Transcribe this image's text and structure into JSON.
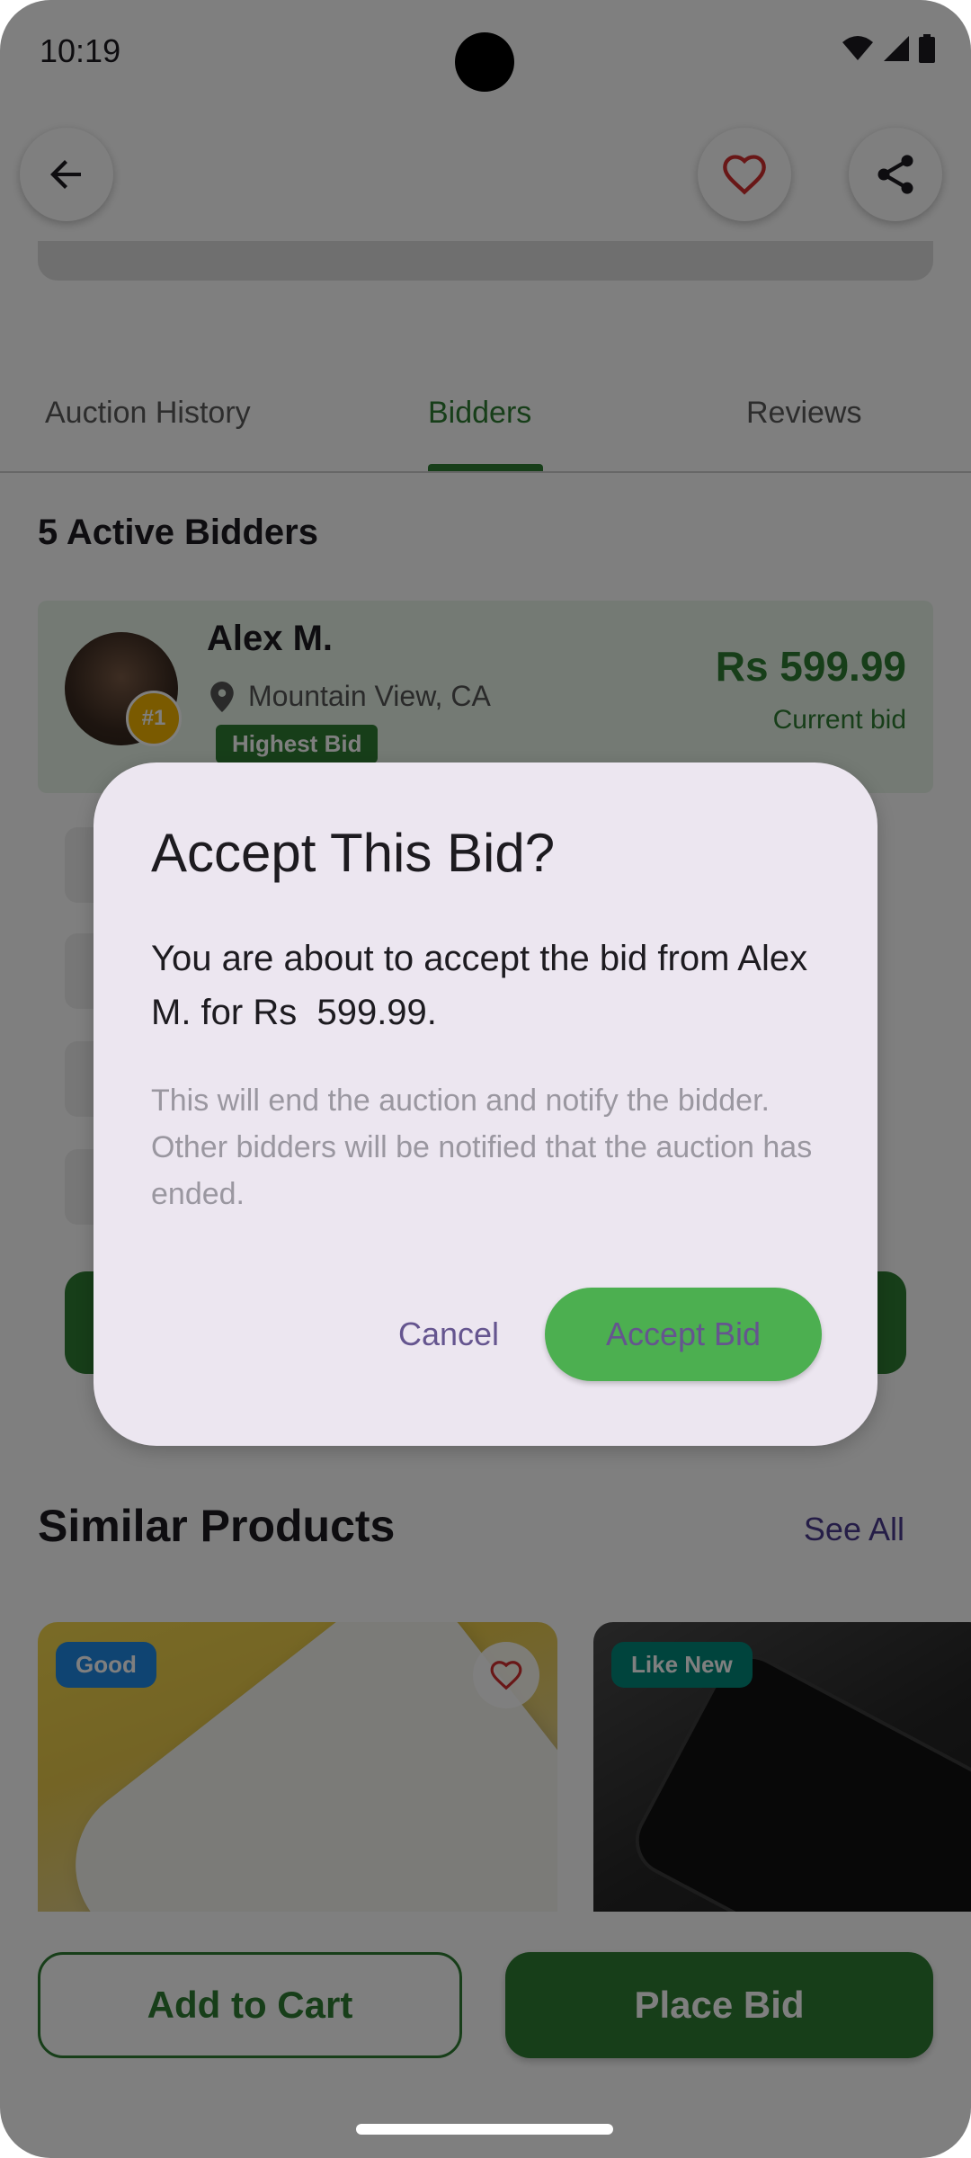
{
  "status_bar": {
    "time": "10:19"
  },
  "tabs": [
    {
      "label": "Auction History"
    },
    {
      "label": "Bidders"
    },
    {
      "label": "Reviews"
    }
  ],
  "bidders": {
    "title": "5 Active Bidders",
    "top": {
      "name": "Alex M.",
      "location": "Mountain View, CA",
      "badge": "Highest Bid",
      "rank": "#1",
      "amount": "Rs 599.99",
      "caption": "Current bid"
    }
  },
  "similar": {
    "title": "Similar Products",
    "see_all": "See All",
    "products": [
      {
        "condition": "Good"
      },
      {
        "condition": "Like New"
      }
    ]
  },
  "actions": {
    "add_to_cart": "Add to Cart",
    "place_bid": "Place Bid"
  },
  "dialog": {
    "title": "Accept This Bid?",
    "body": "You are about to accept the bid from Alex M. for Rs  599.99.",
    "note": "This will end the auction and notify the bidder. Other bidders will be notified that the auction has ended.",
    "cancel": "Cancel",
    "accept": "Accept Bid"
  },
  "colors": {
    "primary_green": "#2e7d32",
    "accept_green": "#4caf50",
    "dialog_surface": "#ece6f0",
    "dialog_action_text": "#65558f",
    "favorite_red": "#d32f2f"
  }
}
